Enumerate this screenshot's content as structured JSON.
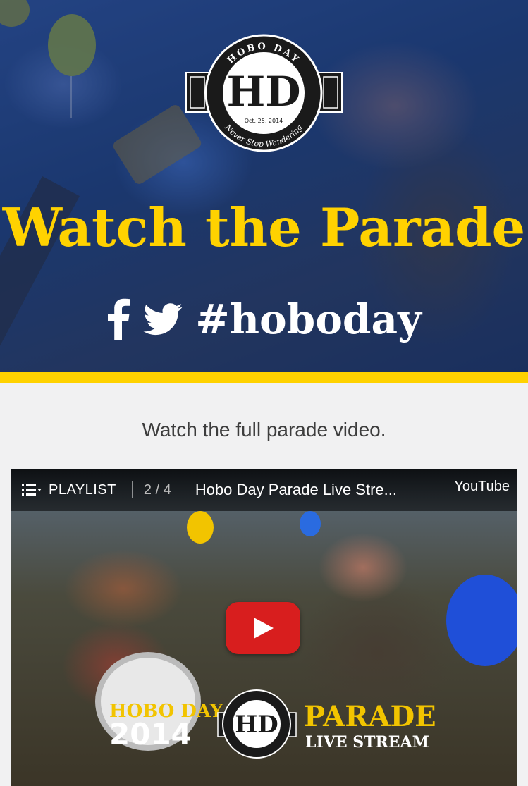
{
  "hero": {
    "title": "Watch the Parade",
    "hashtag": "#hoboday",
    "logo": {
      "arc_top": "HOBO DAY",
      "date": "Oct. 25, 2014",
      "arc_bottom": "Never Stop Wandering",
      "monogram": "HD"
    },
    "social_icons": [
      "facebook-icon",
      "twitter-icon"
    ]
  },
  "body": {
    "subtitle": "Watch the full parade video."
  },
  "video": {
    "playlist_label": "PLAYLIST",
    "count": "2 / 4",
    "title": "Hobo Day Parade Live Stre...",
    "brand": "YouTube",
    "overlay": {
      "hobo_day": "HOBO DAY",
      "year": "2014",
      "parade": "PARADE",
      "live_stream": "LIVE STREAM"
    }
  },
  "colors": {
    "accent_yellow": "#ffd200",
    "hero_blue": "#1f3d70",
    "play_red": "#d81e1e",
    "page_bg": "#f1f1f2"
  }
}
